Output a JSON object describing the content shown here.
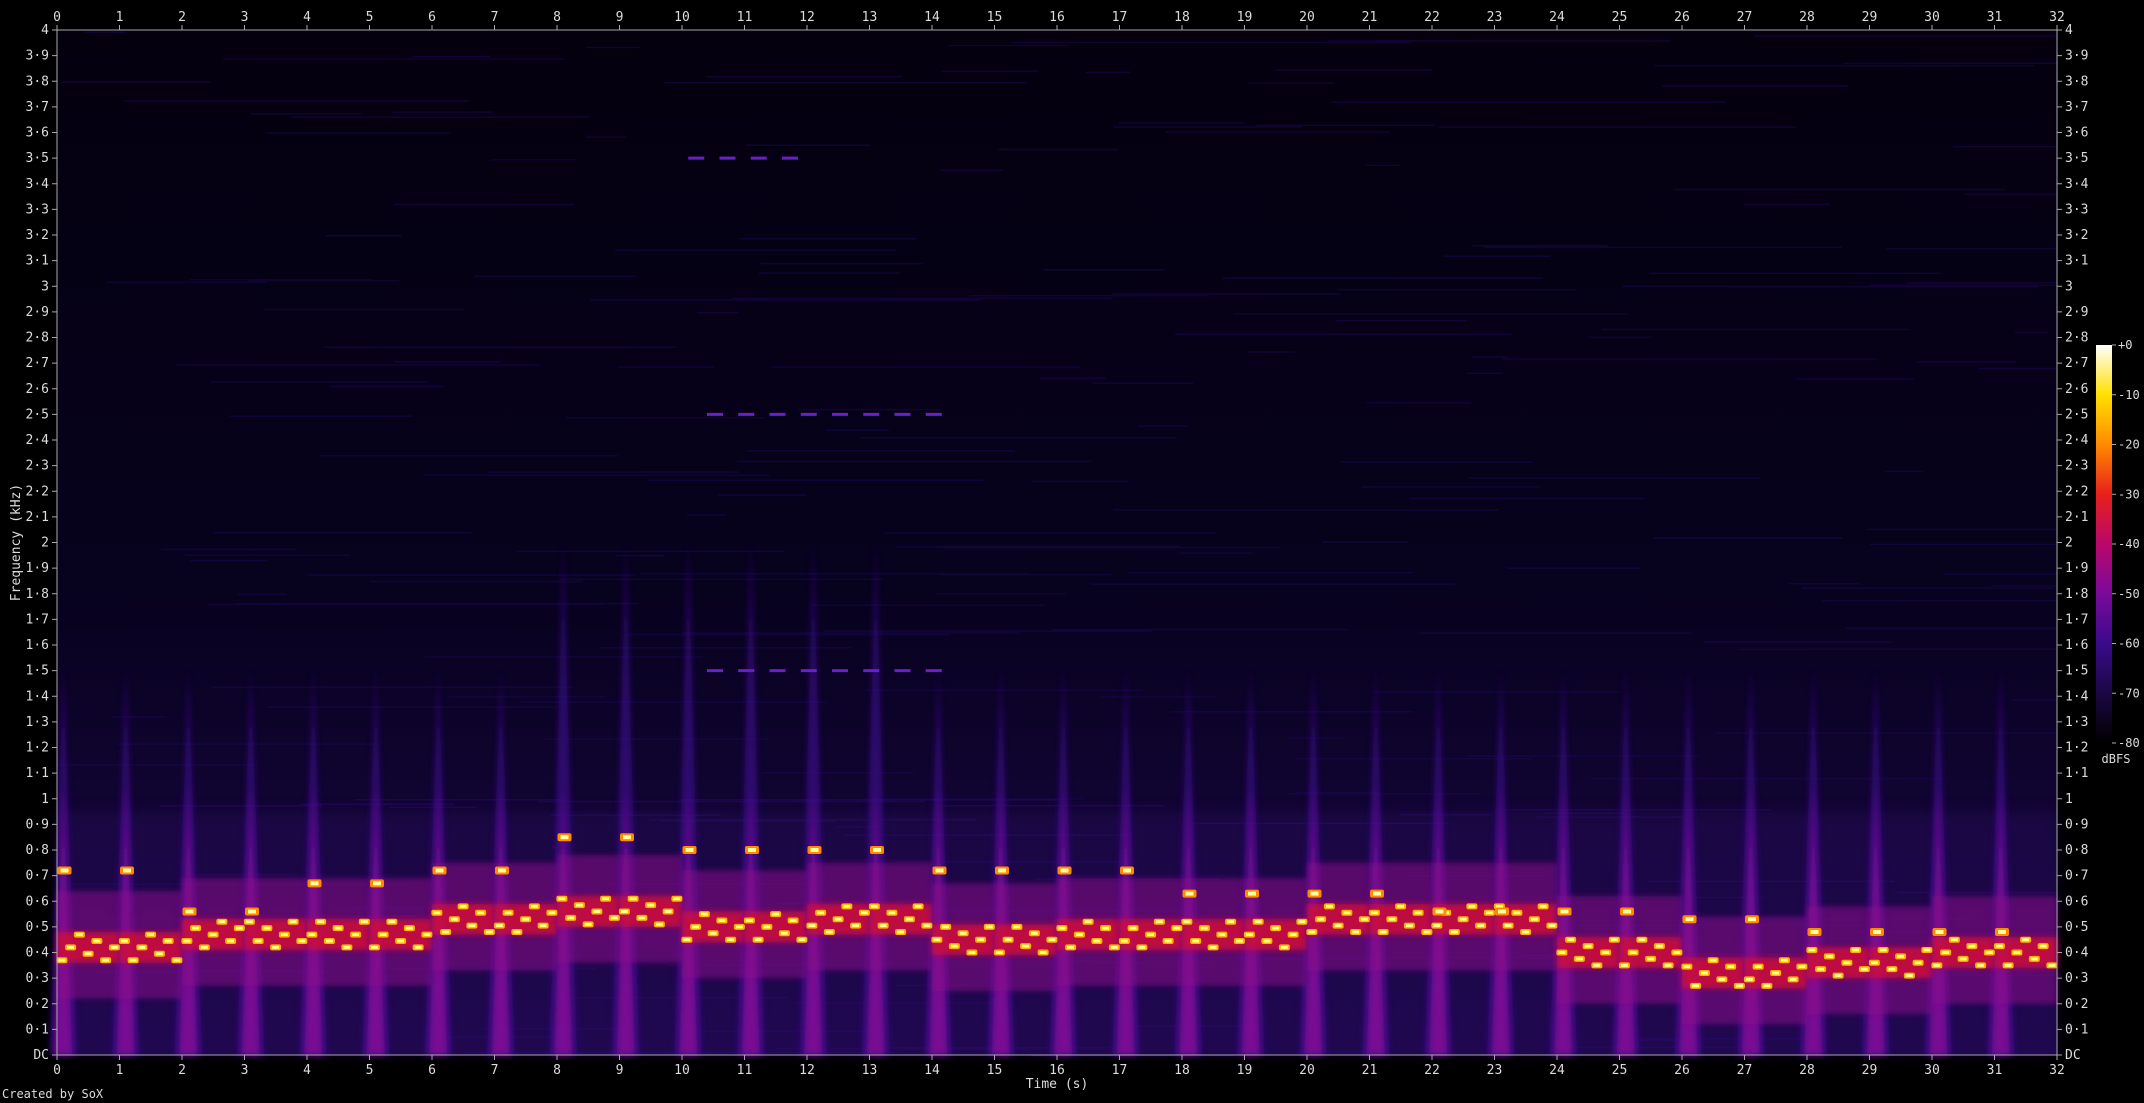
{
  "chart_data": {
    "type": "heatmap",
    "title": "",
    "xlabel": "Time (s)",
    "ylabel": "Frequency (kHz)",
    "xlim": [
      0,
      32
    ],
    "ylim": [
      0,
      4
    ],
    "x_ticks": [
      "0",
      "1",
      "2",
      "3",
      "4",
      "5",
      "6",
      "7",
      "8",
      "9",
      "10",
      "11",
      "12",
      "13",
      "14",
      "15",
      "16",
      "17",
      "18",
      "19",
      "20",
      "21",
      "22",
      "23",
      "24",
      "25",
      "26",
      "27",
      "28",
      "29",
      "30",
      "31",
      "32"
    ],
    "y_ticks": [
      "DC",
      "0·1",
      "0·2",
      "0·3",
      "0·4",
      "0·5",
      "0·6",
      "0·7",
      "0·8",
      "0·9",
      "1",
      "1·1",
      "1·2",
      "1·3",
      "1·4",
      "1·5",
      "1·6",
      "1·7",
      "1·8",
      "1·9",
      "2",
      "2·1",
      "2·2",
      "2·3",
      "2·4",
      "2·5",
      "2·6",
      "2·7",
      "2·8",
      "2·9",
      "3",
      "3·1",
      "3·2",
      "3·3",
      "3·4",
      "3·5",
      "3·6",
      "3·7",
      "3·8",
      "3·9",
      "4"
    ],
    "colorbar": {
      "label": "dBFS",
      "ticks": [
        "+0",
        "-10",
        "-20",
        "-30",
        "-40",
        "-50",
        "-60",
        "-70",
        "-80"
      ],
      "range": [
        -80,
        0
      ],
      "colors": [
        "#000000",
        "#1a0842",
        "#3a0a8a",
        "#7a0a9a",
        "#b8086a",
        "#e8201c",
        "#ff8a00",
        "#ffe000",
        "#ffffff"
      ]
    },
    "note_onsets_s": [
      0,
      1,
      2,
      3,
      4,
      5,
      6,
      7,
      8,
      9,
      10,
      11,
      12,
      13,
      14,
      15,
      16,
      17,
      18,
      19,
      20,
      21,
      22,
      23,
      24,
      25,
      26,
      27,
      28,
      29,
      30,
      31
    ],
    "peak_frequencies_khz": [
      0.72,
      0.72,
      0.56,
      0.56,
      0.67,
      0.67,
      0.72,
      0.72,
      0.85,
      0.85,
      0.8,
      0.8,
      0.8,
      0.8,
      0.72,
      0.72,
      0.72,
      0.72,
      0.63,
      0.63,
      0.63,
      0.63,
      0.56,
      0.56,
      0.56,
      0.56,
      0.53,
      0.53,
      0.48,
      0.48,
      0.48,
      0.48
    ],
    "bass_frequencies_khz": [
      0.42,
      0.42,
      0.47,
      0.47,
      0.47,
      0.47,
      0.53,
      0.53,
      0.56,
      0.56,
      0.5,
      0.5,
      0.53,
      0.53,
      0.45,
      0.45,
      0.47,
      0.47,
      0.47,
      0.47,
      0.53,
      0.53,
      0.53,
      0.53,
      0.4,
      0.4,
      0.32,
      0.32,
      0.36,
      0.36,
      0.4,
      0.4
    ],
    "faint_tones": [
      {
        "freq_khz": 3.5,
        "x_range_s": [
          10.1,
          12.0
        ]
      },
      {
        "freq_khz": 2.5,
        "x_range_s": [
          10.4,
          14.0
        ]
      },
      {
        "freq_khz": 1.5,
        "x_range_s": [
          10.4,
          14.0
        ]
      }
    ]
  },
  "credit": "Created by SoX"
}
